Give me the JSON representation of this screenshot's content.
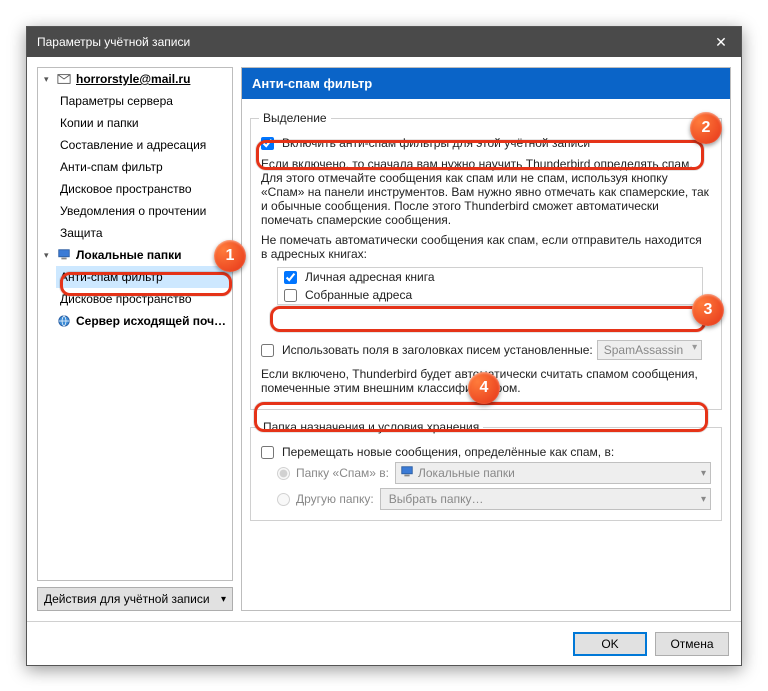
{
  "window": {
    "title": "Параметры учётной записи"
  },
  "tree": {
    "account": "horrorstyle@mail.ru",
    "items": [
      "Параметры сервера",
      "Копии и папки",
      "Составление и адресация",
      "Анти-спам фильтр",
      "Дисковое пространство",
      "Уведомления о прочтении",
      "Защита"
    ],
    "localFolders": "Локальные папки",
    "localItems": [
      "Анти-спам фильтр",
      "Дисковое пространство"
    ],
    "outgoing": "Сервер исходящей поч…"
  },
  "actionsButton": "Действия для учётной записи",
  "header": "Анти-спам фильтр",
  "section1": {
    "legend": "Выделение",
    "enable": "Включить анти-спам фильтры для этой учётной записи",
    "desc": "Если включено, то сначала вам нужно научить Thunderbird определять спам. Для этого отмечайте сообщения как спам или не спам, используя кнопку «Спам» на панели инструментов. Вам нужно явно отмечать как спамерские, так и обычные сообщения. После этого Thunderbird сможет автоматически помечать спамерские сообщения.",
    "whitelistLabel": "Не помечать автоматически сообщения как спам, если отправитель находится в адресных книгах:",
    "books": [
      {
        "label": "Личная адресная книга",
        "checked": true
      },
      {
        "label": "Собранные адреса",
        "checked": false
      }
    ],
    "headersLabel": "Использовать поля в заголовках писем установленные:",
    "headersSelect": "SpamAssassin",
    "headersDesc": "Если включено, Thunderbird будет автоматически считать спамом сообщения, помеченные этим внешним классификатором."
  },
  "section2": {
    "legend": "Папка назначения и условия хранения",
    "moveLabel": "Перемещать новые сообщения, определённые как спам, в:",
    "opt1": "Папку «Спам» в:",
    "opt1val": "Локальные папки",
    "opt2": "Другую папку:",
    "opt2val": "Выбрать папку…"
  },
  "buttons": {
    "ok": "OK",
    "cancel": "Отмена"
  },
  "callouts": {
    "1": "1",
    "2": "2",
    "3": "3",
    "4": "4"
  }
}
